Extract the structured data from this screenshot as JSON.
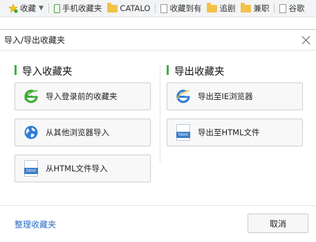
{
  "bookmarks_bar": {
    "items": [
      {
        "label": "收藏",
        "icon": "star-icon"
      },
      {
        "label": "手机收藏夹",
        "icon": "phone-icon"
      },
      {
        "label": "CATALO",
        "icon": "folder-icon"
      },
      {
        "label": "收藏到有",
        "icon": "page-icon"
      },
      {
        "label": "追剧",
        "icon": "folder-icon"
      },
      {
        "label": "兼职",
        "icon": "folder-icon"
      },
      {
        "label": "谷歌",
        "icon": "page-icon"
      }
    ]
  },
  "dialog": {
    "title": "导入/导出收藏夹",
    "import_section": {
      "title": "导入收藏夹",
      "buttons": [
        {
          "label": "导入登录前的收藏夹",
          "icon": "ie-green-icon"
        },
        {
          "label": "从其他浏览器导入",
          "icon": "globe-icon"
        },
        {
          "label": "从HTML文件导入",
          "icon": "html-file-icon"
        }
      ]
    },
    "export_section": {
      "title": "导出收藏夹",
      "buttons": [
        {
          "label": "导出至IE浏览器",
          "icon": "ie-blue-icon"
        },
        {
          "label": "导出至HTML文件",
          "icon": "html-file-icon"
        }
      ]
    },
    "footer": {
      "organize_link": "整理收藏夹",
      "cancel_label": "取消"
    },
    "html_icon_text": "html"
  },
  "colors": {
    "accent_green": "#3fae3f",
    "link_blue": "#2b6cc4",
    "ie_blue": "#2f7fd6",
    "ie_green": "#3aaa35"
  }
}
